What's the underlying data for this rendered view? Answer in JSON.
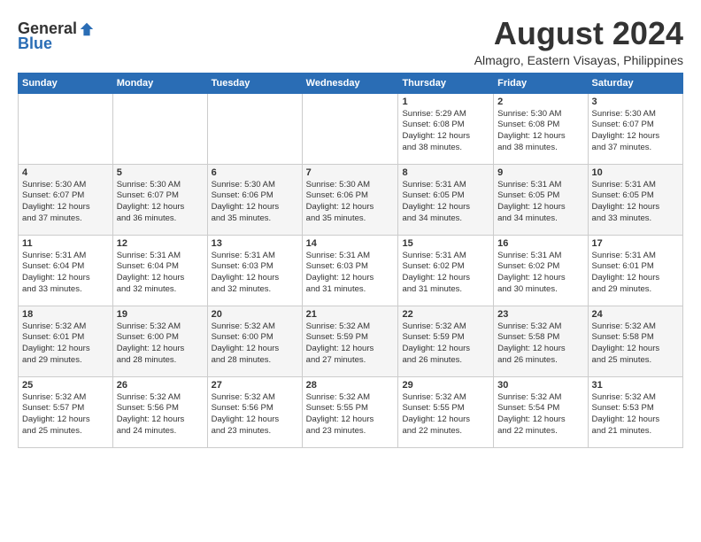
{
  "header": {
    "logo_general": "General",
    "logo_blue": "Blue",
    "title": "August 2024",
    "subtitle": "Almagro, Eastern Visayas, Philippines"
  },
  "calendar": {
    "days_of_week": [
      "Sunday",
      "Monday",
      "Tuesday",
      "Wednesday",
      "Thursday",
      "Friday",
      "Saturday"
    ],
    "weeks": [
      [
        {
          "day": "",
          "info": ""
        },
        {
          "day": "",
          "info": ""
        },
        {
          "day": "",
          "info": ""
        },
        {
          "day": "",
          "info": ""
        },
        {
          "day": "1",
          "info": "Sunrise: 5:29 AM\nSunset: 6:08 PM\nDaylight: 12 hours\nand 38 minutes."
        },
        {
          "day": "2",
          "info": "Sunrise: 5:30 AM\nSunset: 6:08 PM\nDaylight: 12 hours\nand 38 minutes."
        },
        {
          "day": "3",
          "info": "Sunrise: 5:30 AM\nSunset: 6:07 PM\nDaylight: 12 hours\nand 37 minutes."
        }
      ],
      [
        {
          "day": "4",
          "info": "Sunrise: 5:30 AM\nSunset: 6:07 PM\nDaylight: 12 hours\nand 37 minutes."
        },
        {
          "day": "5",
          "info": "Sunrise: 5:30 AM\nSunset: 6:07 PM\nDaylight: 12 hours\nand 36 minutes."
        },
        {
          "day": "6",
          "info": "Sunrise: 5:30 AM\nSunset: 6:06 PM\nDaylight: 12 hours\nand 35 minutes."
        },
        {
          "day": "7",
          "info": "Sunrise: 5:30 AM\nSunset: 6:06 PM\nDaylight: 12 hours\nand 35 minutes."
        },
        {
          "day": "8",
          "info": "Sunrise: 5:31 AM\nSunset: 6:05 PM\nDaylight: 12 hours\nand 34 minutes."
        },
        {
          "day": "9",
          "info": "Sunrise: 5:31 AM\nSunset: 6:05 PM\nDaylight: 12 hours\nand 34 minutes."
        },
        {
          "day": "10",
          "info": "Sunrise: 5:31 AM\nSunset: 6:05 PM\nDaylight: 12 hours\nand 33 minutes."
        }
      ],
      [
        {
          "day": "11",
          "info": "Sunrise: 5:31 AM\nSunset: 6:04 PM\nDaylight: 12 hours\nand 33 minutes."
        },
        {
          "day": "12",
          "info": "Sunrise: 5:31 AM\nSunset: 6:04 PM\nDaylight: 12 hours\nand 32 minutes."
        },
        {
          "day": "13",
          "info": "Sunrise: 5:31 AM\nSunset: 6:03 PM\nDaylight: 12 hours\nand 32 minutes."
        },
        {
          "day": "14",
          "info": "Sunrise: 5:31 AM\nSunset: 6:03 PM\nDaylight: 12 hours\nand 31 minutes."
        },
        {
          "day": "15",
          "info": "Sunrise: 5:31 AM\nSunset: 6:02 PM\nDaylight: 12 hours\nand 31 minutes."
        },
        {
          "day": "16",
          "info": "Sunrise: 5:31 AM\nSunset: 6:02 PM\nDaylight: 12 hours\nand 30 minutes."
        },
        {
          "day": "17",
          "info": "Sunrise: 5:31 AM\nSunset: 6:01 PM\nDaylight: 12 hours\nand 29 minutes."
        }
      ],
      [
        {
          "day": "18",
          "info": "Sunrise: 5:32 AM\nSunset: 6:01 PM\nDaylight: 12 hours\nand 29 minutes."
        },
        {
          "day": "19",
          "info": "Sunrise: 5:32 AM\nSunset: 6:00 PM\nDaylight: 12 hours\nand 28 minutes."
        },
        {
          "day": "20",
          "info": "Sunrise: 5:32 AM\nSunset: 6:00 PM\nDaylight: 12 hours\nand 28 minutes."
        },
        {
          "day": "21",
          "info": "Sunrise: 5:32 AM\nSunset: 5:59 PM\nDaylight: 12 hours\nand 27 minutes."
        },
        {
          "day": "22",
          "info": "Sunrise: 5:32 AM\nSunset: 5:59 PM\nDaylight: 12 hours\nand 26 minutes."
        },
        {
          "day": "23",
          "info": "Sunrise: 5:32 AM\nSunset: 5:58 PM\nDaylight: 12 hours\nand 26 minutes."
        },
        {
          "day": "24",
          "info": "Sunrise: 5:32 AM\nSunset: 5:58 PM\nDaylight: 12 hours\nand 25 minutes."
        }
      ],
      [
        {
          "day": "25",
          "info": "Sunrise: 5:32 AM\nSunset: 5:57 PM\nDaylight: 12 hours\nand 25 minutes."
        },
        {
          "day": "26",
          "info": "Sunrise: 5:32 AM\nSunset: 5:56 PM\nDaylight: 12 hours\nand 24 minutes."
        },
        {
          "day": "27",
          "info": "Sunrise: 5:32 AM\nSunset: 5:56 PM\nDaylight: 12 hours\nand 23 minutes."
        },
        {
          "day": "28",
          "info": "Sunrise: 5:32 AM\nSunset: 5:55 PM\nDaylight: 12 hours\nand 23 minutes."
        },
        {
          "day": "29",
          "info": "Sunrise: 5:32 AM\nSunset: 5:55 PM\nDaylight: 12 hours\nand 22 minutes."
        },
        {
          "day": "30",
          "info": "Sunrise: 5:32 AM\nSunset: 5:54 PM\nDaylight: 12 hours\nand 22 minutes."
        },
        {
          "day": "31",
          "info": "Sunrise: 5:32 AM\nSunset: 5:53 PM\nDaylight: 12 hours\nand 21 minutes."
        }
      ]
    ]
  }
}
